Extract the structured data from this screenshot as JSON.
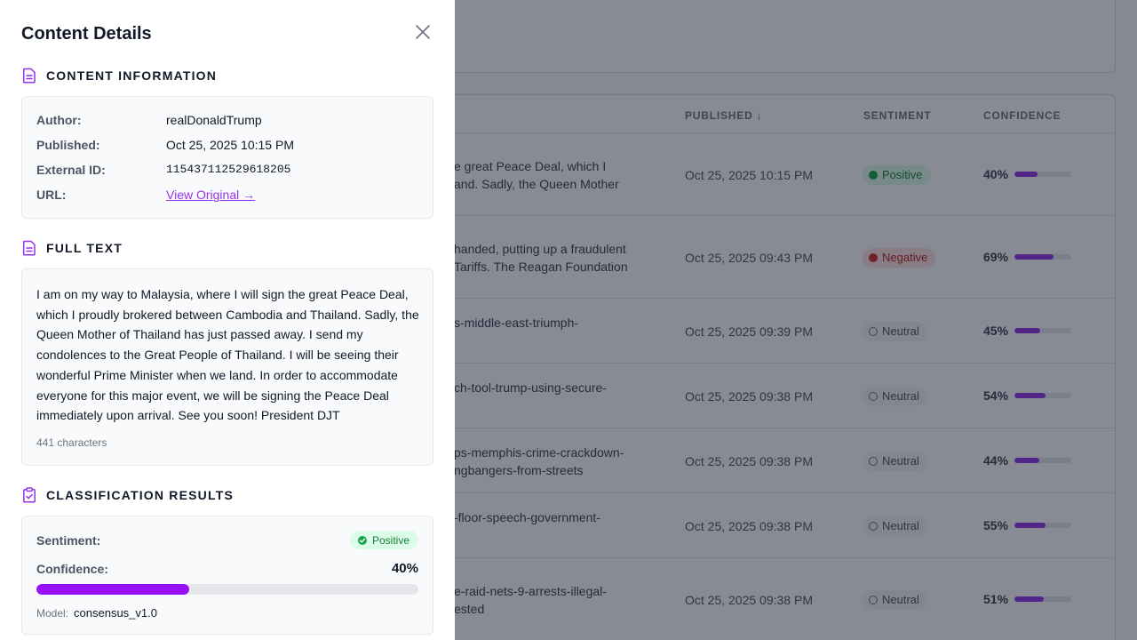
{
  "drawer": {
    "title": "Content Details",
    "sections": {
      "info": {
        "heading": "CONTENT INFORMATION",
        "rows": {
          "author": {
            "label": "Author:",
            "value": "realDonaldTrump"
          },
          "published": {
            "label": "Published:",
            "value": "Oct 25, 2025 10:15 PM"
          },
          "external_id": {
            "label": "External ID:",
            "value": "115437112529618205"
          },
          "url": {
            "label": "URL:",
            "value": "View Original →"
          }
        }
      },
      "fulltext": {
        "heading": "FULL TEXT",
        "body": "I am on my way to Malaysia, where I will sign the great Peace Deal, which I proudly brokered between Cambodia and Thailand. Sadly, the Queen Mother of Thailand has just passed away. I send my condolences to the Great People of Thailand. I will be seeing their wonderful Prime Minister when we land. In order to accommodate everyone for this major event, we will be signing the Peace Deal immediately upon arrival. See you soon! President DJT",
        "char_count": "441 characters"
      },
      "classification": {
        "heading": "CLASSIFICATION RESULTS",
        "sentiment_label": "Sentiment:",
        "sentiment_value": "Positive",
        "confidence_label": "Confidence:",
        "confidence_value": "40%",
        "confidence_fraction": 0.4,
        "model_label": "Model:",
        "model_value": "consensus_v1.0"
      }
    }
  },
  "background_table": {
    "headers": {
      "published": "PUBLISHED",
      "sentiment": "SENTIMENT",
      "confidence": "CONFIDENCE"
    },
    "rows": [
      {
        "text": "e great Peace Deal, which I\nand. Sadly, the Queen Mother",
        "date": "Oct 25, 2025 10:15 PM",
        "sentiment": "Positive",
        "kind": "pos",
        "confidence": "40%",
        "fraction": 0.4
      },
      {
        "text": "handed, putting up a fraudulent\nTariffs. The Reagan Foundation",
        "date": "Oct 25, 2025 09:43 PM",
        "sentiment": "Negative",
        "kind": "neg",
        "confidence": "69%",
        "fraction": 0.69
      },
      {
        "text": "s-middle-east-triumph-",
        "date": "Oct 25, 2025 09:39 PM",
        "sentiment": "Neutral",
        "kind": "neu",
        "confidence": "45%",
        "fraction": 0.45
      },
      {
        "text": "ch-tool-trump-using-secure-",
        "date": "Oct 25, 2025 09:38 PM",
        "sentiment": "Neutral",
        "kind": "neu",
        "confidence": "54%",
        "fraction": 0.54
      },
      {
        "text": "ps-memphis-crime-crackdown-\nngbangers-from-streets",
        "date": "Oct 25, 2025 09:38 PM",
        "sentiment": "Neutral",
        "kind": "neu",
        "confidence": "44%",
        "fraction": 0.44
      },
      {
        "text": "-floor-speech-government-",
        "date": "Oct 25, 2025 09:38 PM",
        "sentiment": "Neutral",
        "kind": "neu",
        "confidence": "55%",
        "fraction": 0.55
      },
      {
        "text": "e-raid-nets-9-arrests-illegal-\nested",
        "date": "Oct 25, 2025 09:38 PM",
        "sentiment": "Neutral",
        "kind": "neu",
        "confidence": "51%",
        "fraction": 0.51
      }
    ]
  },
  "colors": {
    "accent": "#9333ea",
    "confidence_fill": "#9810fa",
    "positive": "#16a34a",
    "negative": "#dc2626",
    "overlay": "rgba(17,24,39,0.5)"
  },
  "icons": {
    "close": "close-icon",
    "info_section": "document-icon",
    "text_section": "document-icon",
    "classification_section": "clipboard-check-icon",
    "sort": "arrow-down-icon",
    "positive": "check-circle-icon",
    "negative": "x-circle-icon",
    "neutral": "circle-icon"
  }
}
